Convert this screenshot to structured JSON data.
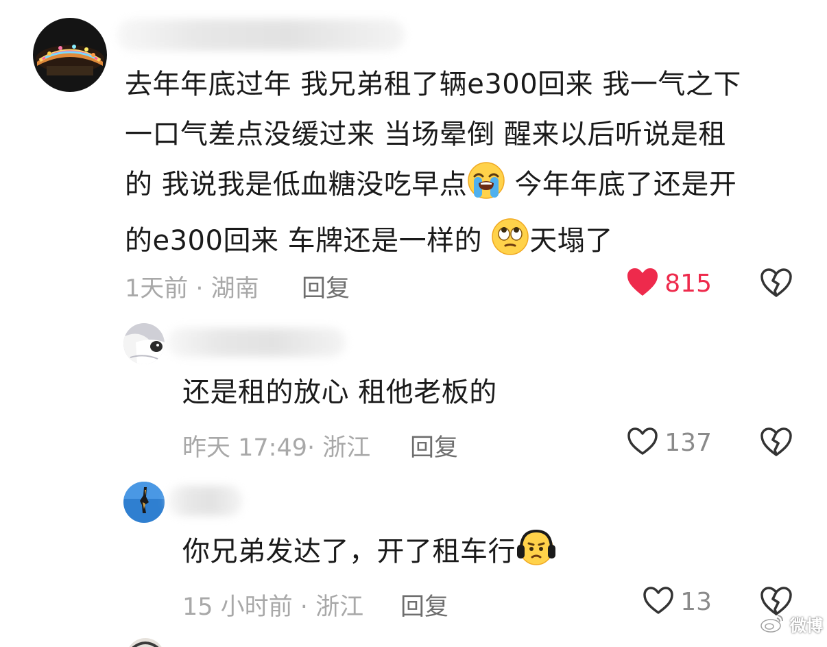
{
  "comments": [
    {
      "text_segments": [
        "去年年底过年 我兄弟租了辆e300回来 我一气之下",
        "一口气差点没缓过来 当场晕倒 醒来以后听说是租",
        "的 我说我是低血糖没吃早点",
        " 今年年底了还是开",
        "的e300回来 车牌还是一样的 ",
        "天塌了"
      ],
      "time": "1天前",
      "separator": " · ",
      "location": "湖南",
      "reply_label": "回复",
      "likes": "815",
      "liked": true
    },
    {
      "text": "还是租的放心 租他老板的",
      "time": "昨天 17:49",
      "separator": "· ",
      "location": "浙江",
      "reply_label": "回复",
      "likes": "137",
      "liked": false
    },
    {
      "text": "你兄弟发达了，开了租车行",
      "time": "15 小时前",
      "separator": " · ",
      "location": "浙江",
      "reply_label": "回复",
      "likes": "13",
      "liked": false
    }
  ],
  "icons": {
    "like": "heart-icon",
    "dislike": "broken-heart-icon",
    "emoji_1": "loudly-crying-face-emoji",
    "emoji_2": "face-with-rolling-eyes-emoji",
    "emoji_3": "headphones-face-emoji"
  },
  "colors": {
    "like_active": "#ee2a4c",
    "meta_text": "#a8a8a8",
    "reply_text": "#6e6e6e",
    "body_text": "#1a1a1a"
  },
  "watermark": {
    "text": "微博"
  }
}
